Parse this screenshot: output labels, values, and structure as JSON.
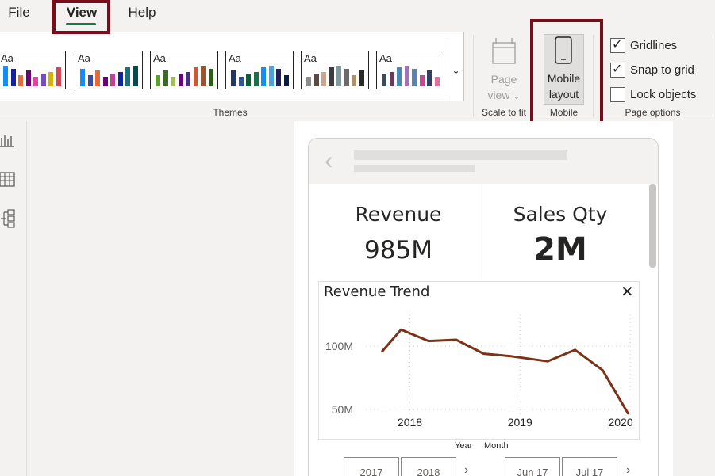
{
  "menu": {
    "file": "File",
    "view": "View",
    "help": "Help"
  },
  "ribbon": {
    "themes_group": "Themes",
    "theme_aa": "Aa",
    "themes": [
      {
        "colors": [
          "#118dff",
          "#12239e",
          "#e66c37",
          "#6b007b",
          "#e044a7",
          "#744ec2",
          "#d9b300",
          "#d64550"
        ]
      },
      {
        "colors": [
          "#118dff",
          "#3c4a9e",
          "#e66c37",
          "#6b007b",
          "#c83d95",
          "#12239e",
          "#197278",
          "#004b50"
        ]
      },
      {
        "colors": [
          "#5c9e31",
          "#3b6a28",
          "#a3be5c",
          "#6b007b",
          "#4b2d85",
          "#c45b3a",
          "#a0522d",
          "#2c5e1a"
        ]
      },
      {
        "colors": [
          "#1f3864",
          "#2f5597",
          "#0d5d3d",
          "#1e7145",
          "#118dff",
          "#4aa3df",
          "#202060",
          "#0a1a40"
        ]
      },
      {
        "colors": [
          "#8c8c8c",
          "#5a4a42",
          "#c9a58f",
          "#3d3d3d",
          "#7f9aa0",
          "#6b6b6b",
          "#b0906a",
          "#2a2a2a"
        ]
      },
      {
        "colors": [
          "#3c4a5a",
          "#6b3a5a",
          "#4a8ab0",
          "#a074b0",
          "#6080b0",
          "#c04a8a",
          "#304060",
          "#e070a0"
        ]
      }
    ],
    "page_view": {
      "line1": "Page",
      "line2": "view",
      "chevron": "⌄"
    },
    "scale_group": "Scale to fit",
    "mobile_layout": {
      "line1": "Mobile",
      "line2": "layout"
    },
    "mobile_group": "Mobile",
    "page_options": {
      "group": "Page options",
      "gridlines": {
        "label": "Gridlines",
        "checked": true
      },
      "snap_to_grid": {
        "label": "Snap to grid",
        "checked": true
      },
      "lock_objects": {
        "label": "Lock objects",
        "checked": false
      }
    }
  },
  "cards": {
    "revenue": {
      "title": "Revenue",
      "value": "985M"
    },
    "sales_qty": {
      "title": "Sales Qty",
      "value": "2M"
    }
  },
  "chart_title": "Revenue Trend",
  "chart_data": {
    "type": "line",
    "title": "Revenue Trend",
    "xlabel": "",
    "ylabel": "",
    "x_ticks": [
      "2018",
      "2019",
      "2020"
    ],
    "y_ticks": [
      "100M",
      "50M"
    ],
    "ylim": [
      45,
      125
    ],
    "x": [
      2017.75,
      2017.92,
      2018.17,
      2018.42,
      2018.67,
      2018.92,
      2019.25,
      2019.5,
      2019.75,
      2019.98
    ],
    "values": [
      96,
      113,
      104,
      105,
      94,
      92,
      88,
      97,
      81,
      47
    ],
    "color": "#7a3318"
  },
  "slicers": {
    "year_label": "Year",
    "month_label": "Month",
    "years": [
      "2017",
      "2018"
    ],
    "months": [
      "Jun 17",
      "Jul 17"
    ],
    "arrow": "›"
  },
  "icons": {
    "back": "‹",
    "close": "✕",
    "dropdown": "⌄"
  }
}
